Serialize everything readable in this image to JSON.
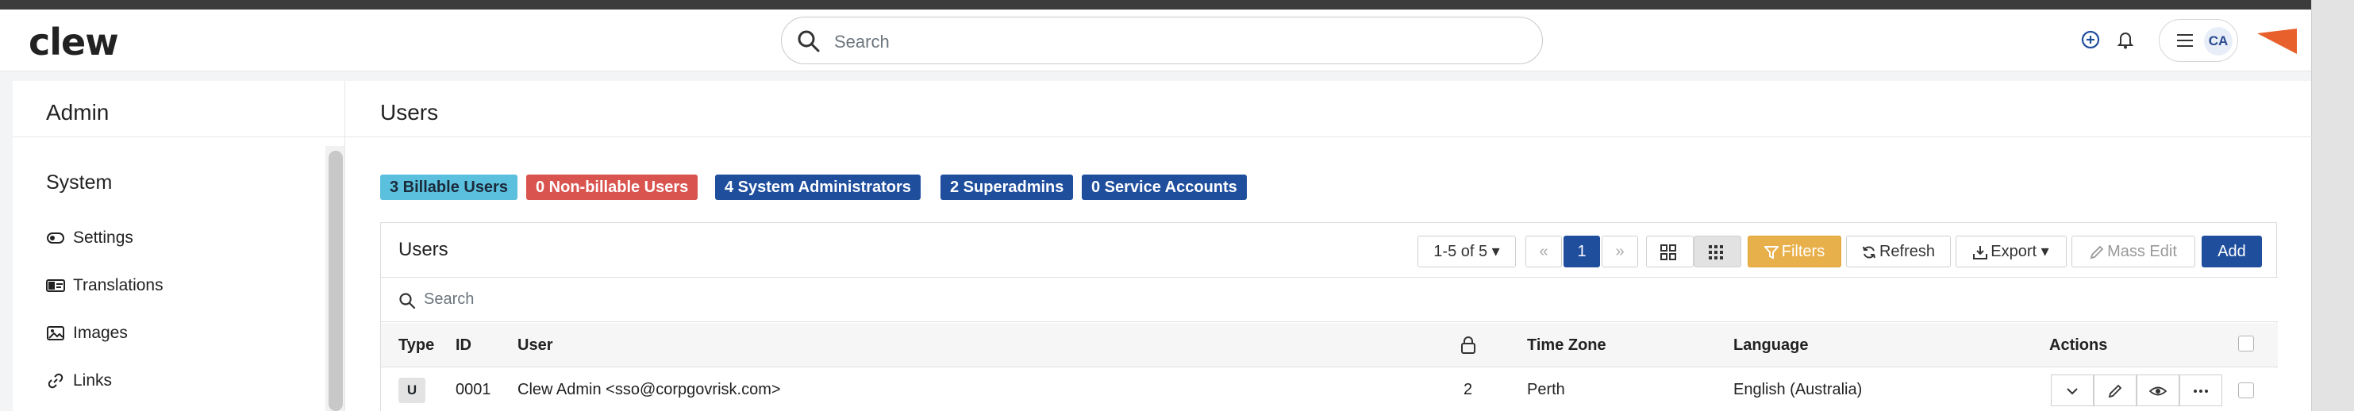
{
  "app": {
    "logo": "clew"
  },
  "header": {
    "search_placeholder": "Search",
    "avatar_initials": "CA",
    "icons": [
      "add-circle-icon",
      "bell-icon",
      "menu-icon",
      "brand-triangle-icon"
    ]
  },
  "sidebar": {
    "title": "Admin",
    "section": "System",
    "items": [
      {
        "label": "Settings",
        "icon": "toggle-icon"
      },
      {
        "label": "Translations",
        "icon": "translate-icon"
      },
      {
        "label": "Images",
        "icon": "image-icon"
      },
      {
        "label": "Links",
        "icon": "link-icon"
      }
    ]
  },
  "page": {
    "title": "Users",
    "badges": [
      {
        "label": "3 Billable Users",
        "color": "#5bc0de"
      },
      {
        "label": "0 Non-billable Users",
        "color": "#d9534f"
      },
      {
        "label": "4 System Administrators",
        "color": "#1f4e9d"
      },
      {
        "label": "2 Superadmins",
        "color": "#1f4e9d"
      },
      {
        "label": "0 Service Accounts",
        "color": "#1f4e9d"
      }
    ]
  },
  "table": {
    "title": "Users",
    "range": "1-5 of 5",
    "current_page": "1",
    "toolbar": {
      "filters": "Filters",
      "refresh": "Refresh",
      "export": "Export",
      "mass_edit": "Mass Edit",
      "add": "Add"
    },
    "search_placeholder": "Search",
    "columns": [
      "Type",
      "ID",
      "User",
      "",
      "Time Zone",
      "Language",
      "Actions"
    ],
    "rows": [
      {
        "type": "U",
        "id": "0001",
        "user": "Clew Admin <sso@corpgovrisk.com>",
        "count": "2",
        "time_zone": "Perth",
        "language": "English (Australia)"
      }
    ]
  },
  "colors": {
    "accent": "#1f4e9d",
    "filters_bg": "#e8b04b",
    "brand_orange": "#e8602c"
  }
}
